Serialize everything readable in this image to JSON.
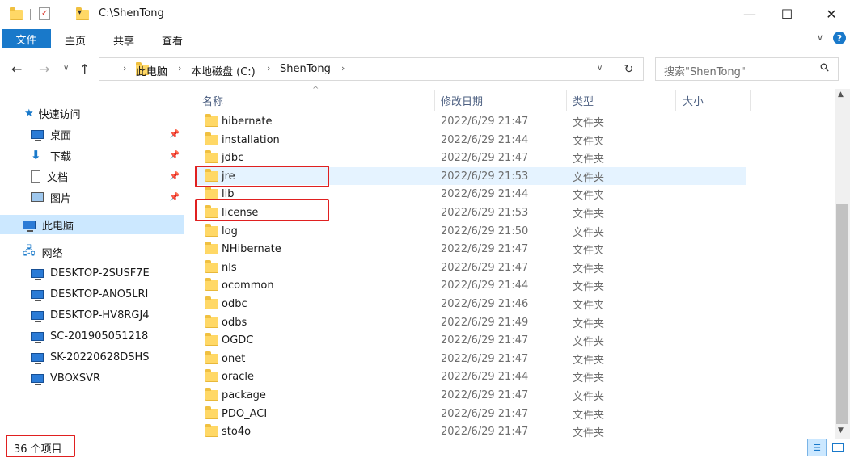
{
  "window": {
    "title": "C:\\ShenTong",
    "minimize": "—",
    "maximize": "☐",
    "close": "✕"
  },
  "ribbon": {
    "file": "文件",
    "tabs": [
      "主页",
      "共享",
      "查看"
    ],
    "expand": "∨",
    "help": "?"
  },
  "nav": {
    "back": "←",
    "forward": "→",
    "recent": "∨",
    "up": "↑",
    "breadcrumb": [
      "此电脑",
      "本地磁盘 (C:)",
      "ShenTong"
    ],
    "dropdown": "∨",
    "refresh": "↻",
    "search_placeholder": "搜索\"ShenTong\"",
    "search_icon": "⚲"
  },
  "sidebar": {
    "quick_access": "快速访问",
    "quick_items": [
      {
        "label": "桌面",
        "icon": "desktop-icon"
      },
      {
        "label": "下载",
        "icon": "download-icon"
      },
      {
        "label": "文档",
        "icon": "document-icon"
      },
      {
        "label": "图片",
        "icon": "pictures-icon"
      }
    ],
    "this_pc": "此电脑",
    "network": "网络",
    "network_items": [
      "DESKTOP-2SUSF7E",
      "DESKTOP-ANO5LRI",
      "DESKTOP-HV8RGJ4",
      "SC-201905051218",
      "SK-20220628DSHS",
      "VBOXSVR"
    ]
  },
  "columns": {
    "name": "名称",
    "modified": "修改日期",
    "type": "类型",
    "size": "大小"
  },
  "files": [
    {
      "name": "hibernate",
      "date": "2022/6/29 21:47",
      "type": "文件夹"
    },
    {
      "name": "installation",
      "date": "2022/6/29 21:44",
      "type": "文件夹"
    },
    {
      "name": "jdbc",
      "date": "2022/6/29 21:47",
      "type": "文件夹"
    },
    {
      "name": "jre",
      "date": "2022/6/29 21:53",
      "type": "文件夹"
    },
    {
      "name": "lib",
      "date": "2022/6/29 21:44",
      "type": "文件夹"
    },
    {
      "name": "license",
      "date": "2022/6/29 21:53",
      "type": "文件夹"
    },
    {
      "name": "log",
      "date": "2022/6/29 21:50",
      "type": "文件夹"
    },
    {
      "name": "NHibernate",
      "date": "2022/6/29 21:47",
      "type": "文件夹"
    },
    {
      "name": "nls",
      "date": "2022/6/29 21:47",
      "type": "文件夹"
    },
    {
      "name": "ocommon",
      "date": "2022/6/29 21:44",
      "type": "文件夹"
    },
    {
      "name": "odbc",
      "date": "2022/6/29 21:46",
      "type": "文件夹"
    },
    {
      "name": "odbs",
      "date": "2022/6/29 21:49",
      "type": "文件夹"
    },
    {
      "name": "OGDC",
      "date": "2022/6/29 21:47",
      "type": "文件夹"
    },
    {
      "name": "onet",
      "date": "2022/6/29 21:47",
      "type": "文件夹"
    },
    {
      "name": "oracle",
      "date": "2022/6/29 21:44",
      "type": "文件夹"
    },
    {
      "name": "package",
      "date": "2022/6/29 21:47",
      "type": "文件夹"
    },
    {
      "name": "PDO_ACI",
      "date": "2022/6/29 21:47",
      "type": "文件夹"
    },
    {
      "name": "sto4o",
      "date": "2022/6/29 21:47",
      "type": "文件夹"
    }
  ],
  "status": {
    "item_count": "36 个项目"
  },
  "colors": {
    "accent": "#1979ca",
    "selection": "#cce8ff",
    "highlight_box": "#e02020"
  }
}
